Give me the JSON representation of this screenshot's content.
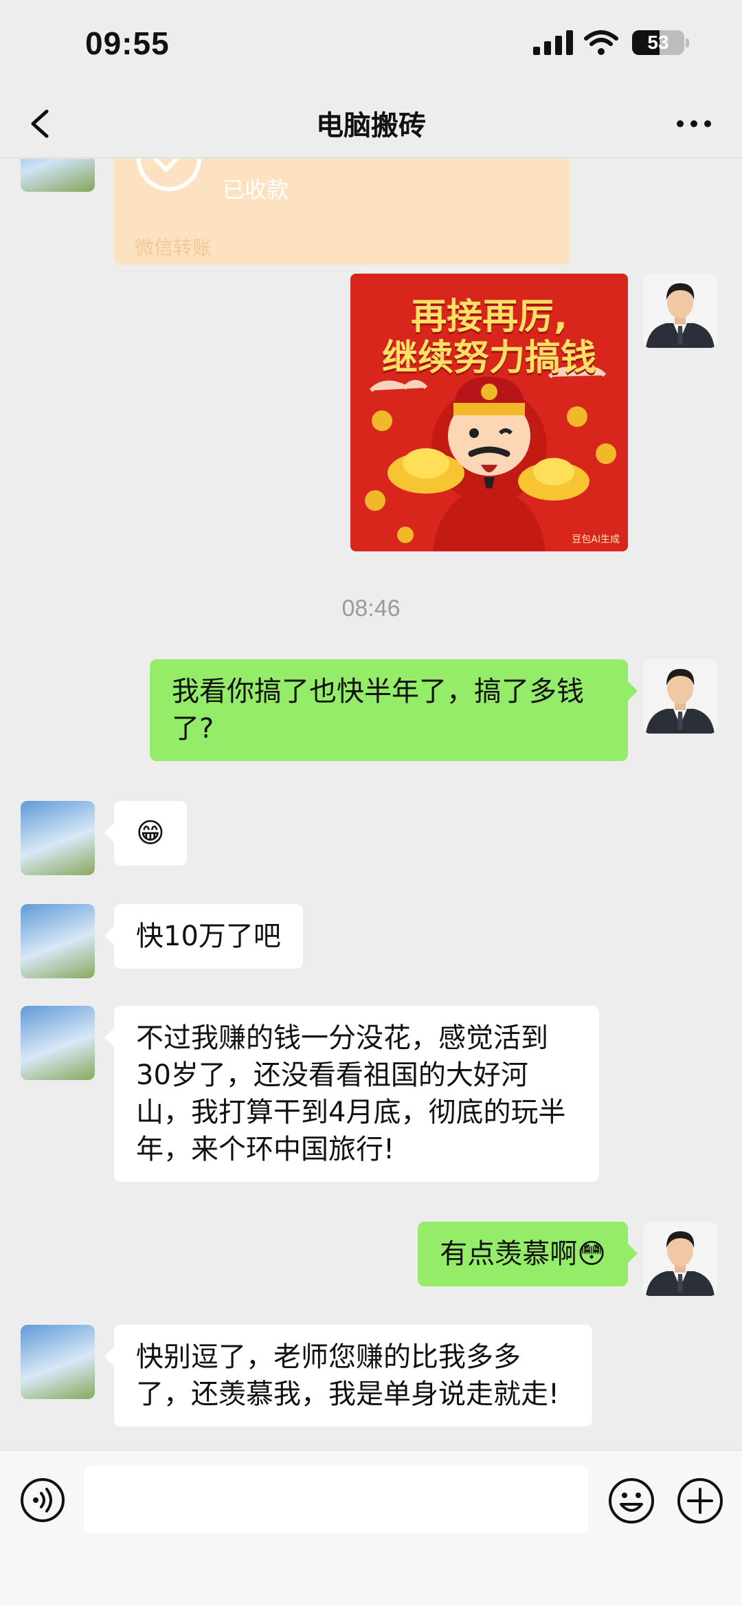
{
  "status_bar": {
    "time": "09:55",
    "battery_level": "53"
  },
  "nav": {
    "title": "电脑搬砖"
  },
  "chat": {
    "transfer": {
      "status": "已收款",
      "footer": "微信转账"
    },
    "sticker": {
      "line1": "再接再厉,",
      "line2": "继续努力搞钱",
      "watermark": "豆包AI生成"
    },
    "timestamp": "08:46",
    "messages": [
      {
        "side": "self",
        "text": "我看你搞了也快半年了，搞了多钱了?"
      },
      {
        "side": "other",
        "text": "😁"
      },
      {
        "side": "other",
        "text": "快10万了吧"
      },
      {
        "side": "other",
        "text": "不过我赚的钱一分没花，感觉活到30岁了，还没看看祖国的大好河山，我打算干到4月底，彻底的玩半年，来个环中国旅行!"
      },
      {
        "side": "self",
        "text": "有点羡慕啊😳"
      },
      {
        "side": "other",
        "text": "快别逗了，老师您赚的比我多多了，还羡慕我，我是单身说走就走!"
      }
    ]
  },
  "icons": {
    "back": "chevron-left-icon",
    "more": "more-dots-icon",
    "voice": "voice-icon",
    "emoji": "emoji-icon",
    "plus": "plus-icon"
  },
  "colors": {
    "self_bubble": "#95ec69",
    "other_bubble": "#ffffff",
    "background": "#ededed",
    "transfer_card": "#fde2c2"
  }
}
